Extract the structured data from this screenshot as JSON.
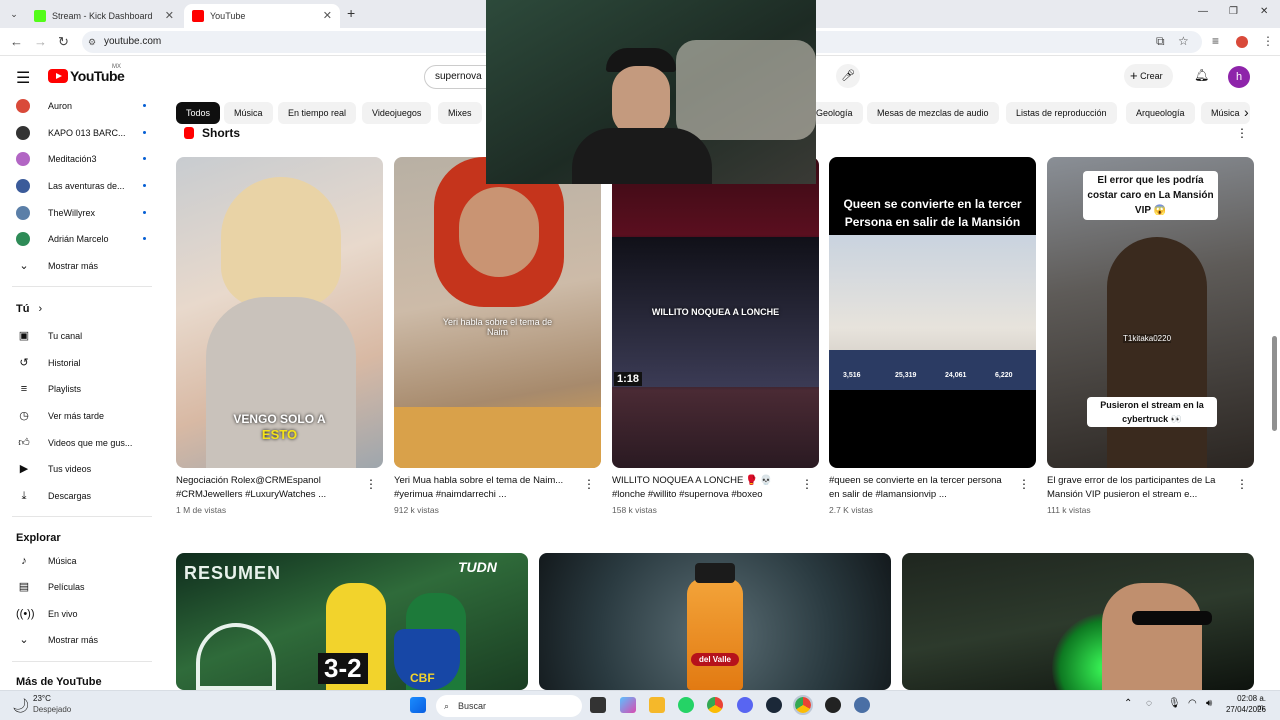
{
  "browser": {
    "tabs": [
      {
        "title": "Stream - Kick Dashboard",
        "favicon_color": "#53fc18"
      },
      {
        "title": "YouTube",
        "favicon_color": "#ff0000"
      }
    ],
    "url": "youtube.com",
    "new_tab_icon": "plus-icon",
    "window_controls": [
      "minimize-icon",
      "maximize-icon",
      "close-icon"
    ]
  },
  "youtube": {
    "logo_text": "YouTube",
    "region": "MX",
    "search_value": "supernova",
    "create_label": "Crear",
    "avatar_letter": "h",
    "accent_color": "#ff0000"
  },
  "sidebar": {
    "subscriptions": [
      {
        "name": "Auron",
        "color": "#d94a3a"
      },
      {
        "name": "KAPO 013 BARC...",
        "color": "#333333"
      },
      {
        "name": "Meditación3",
        "color": "#b266c4"
      },
      {
        "name": "Las aventuras de...",
        "color": "#3b5b9a"
      },
      {
        "name": "TheWillyrex",
        "color": "#5b7fa8"
      },
      {
        "name": "Adrián Marcelo",
        "color": "#2e8b57"
      }
    ],
    "show_more": "Mostrar más",
    "you_section": "Tú",
    "you_items": [
      "Tu canal",
      "Historial",
      "Playlists",
      "Ver más tarde",
      "Videos que me gus...",
      "Tus videos",
      "Descargas"
    ],
    "explore_title": "Explorar",
    "explore_items": [
      "Música",
      "Películas",
      "En vivo"
    ],
    "explore_more": "Mostrar más",
    "more_title": "Más de YouTube"
  },
  "chips": [
    "Todos",
    "Música",
    "En tiempo real",
    "Videojuegos",
    "Mixes",
    "Geología",
    "Mesas de mezclas de audio",
    "Listas de reproducción",
    "Arqueología",
    "Música"
  ],
  "shorts": {
    "title": "Shorts",
    "items": [
      {
        "title": "Negociación Rolex@CRMEspanol #CRMJewellers #LuxuryWatches ...",
        "views": "1 M de vistas",
        "caption1": "VENGO SOLO A",
        "caption2": "ESTO"
      },
      {
        "title": "Yeri Mua habla sobre el tema de Naim... #yerimua #naimdarrechi ...",
        "views": "912 k vistas",
        "caption1": "Yeri habla sobre el tema de Naim"
      },
      {
        "title": "WILLITO NOQUEA A LONCHE 🥊 💀 #lonche #willito #supernova #boxeo",
        "views": "158 k vistas",
        "caption1": "WILLITO NOQUEA A LONCHE",
        "timer": "1:18"
      },
      {
        "title": "#queen se convierte en la tercer persona en salir de #lamansionvip ...",
        "views": "2.7 K vistas",
        "caption1": "Queen se convierte en la tercer Persona en salir de la Mansión VIP",
        "scores": [
          "3,516",
          "25,319",
          "24,061",
          "6,220"
        ]
      },
      {
        "title": "El grave error de los participantes de La Mansión VIP pusieron el stream e...",
        "views": "111 k vistas",
        "caption1": "El error que les podría costar caro en La Mansión VIP 😱",
        "caption2": "Pusieron el stream en la cybertruck 👀",
        "tag": "T1kitaka0220"
      }
    ]
  },
  "videos": [
    {
      "badge": "TUDN",
      "overlay": "RESUMEN",
      "score": "3-2",
      "team": "CBF"
    },
    {
      "brand": "del Valle"
    },
    {
      "overlay": ""
    }
  ],
  "taskbar": {
    "weather_temp": "23°C",
    "weather_desc": "Despejado",
    "search_placeholder": "Buscar",
    "time": "02:08 a. m.",
    "date": "27/04/2026"
  }
}
